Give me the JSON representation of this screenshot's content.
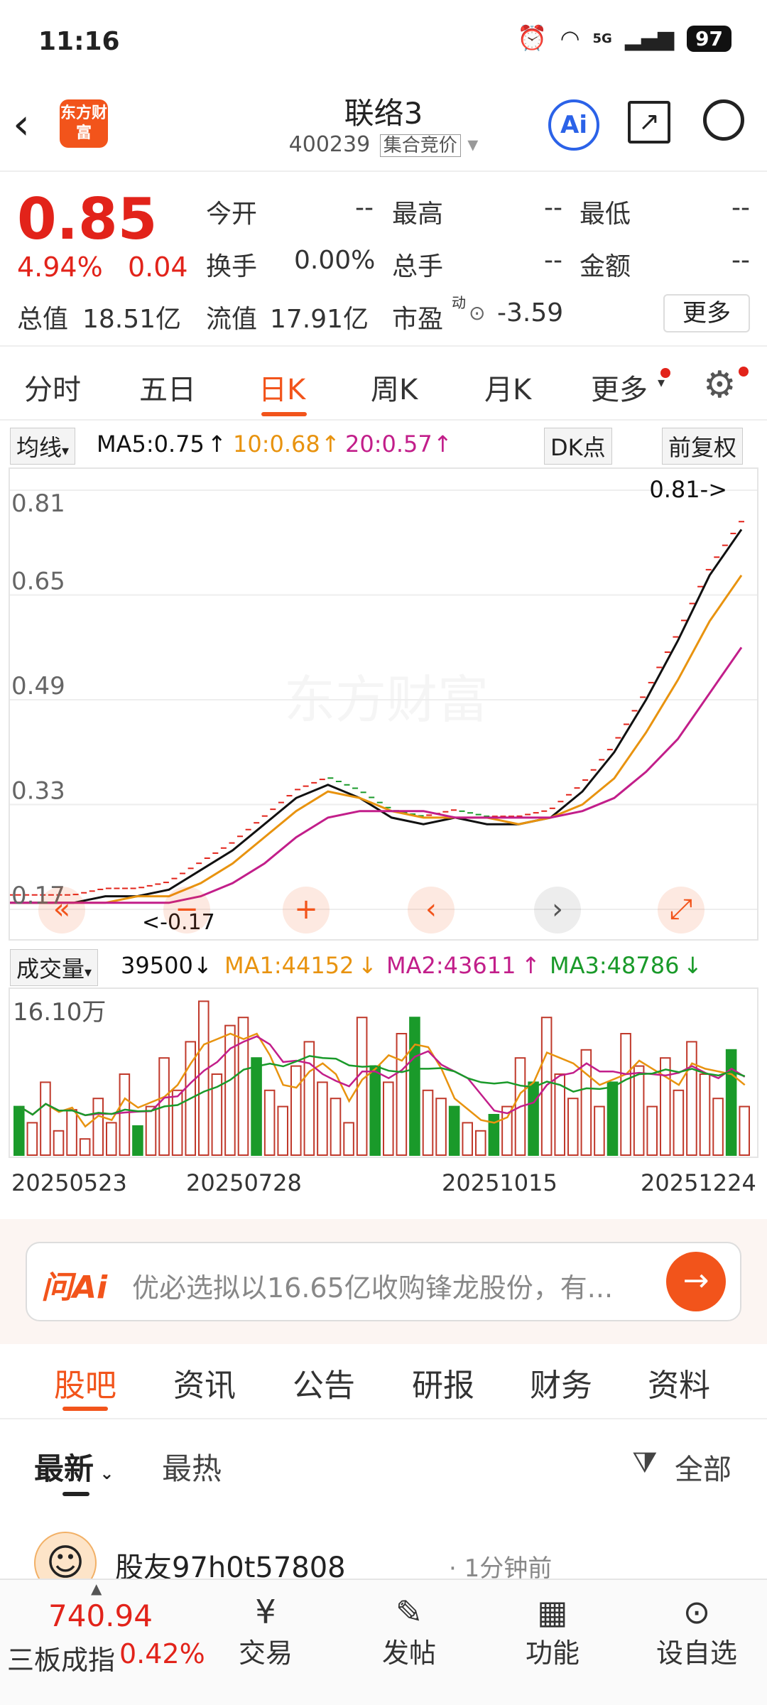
{
  "status": {
    "time": "11:16",
    "network": "5G",
    "battery": "97"
  },
  "header": {
    "logo_text": "东方财富",
    "title": "联络3",
    "code": "400239",
    "mode": "集合竞价",
    "ai_label": "Ai"
  },
  "quote": {
    "price": "0.85",
    "change_pct": "4.94%",
    "change": "0.04",
    "open_label": "今开",
    "open": "--",
    "high_label": "最高",
    "high": "--",
    "low_label": "最低",
    "low": "--",
    "turnover_label": "换手",
    "turnover": "0.00%",
    "volume_label": "总手",
    "volume": "--",
    "amount_label": "金额",
    "amount": "--",
    "mktcap_label": "总值",
    "mktcap": "18.51亿",
    "float_label": "流值",
    "float": "17.91亿",
    "pe_label": "市盈",
    "pe_sup": "动",
    "pe": "-3.59",
    "more": "更多"
  },
  "tabs": [
    "分时",
    "五日",
    "日K",
    "周K",
    "月K",
    "更多"
  ],
  "ma": {
    "label": "均线",
    "ma5": "MA5:0.75",
    "ma10": "10:0.68",
    "ma20": "20:0.57",
    "dk": "DK点",
    "adj": "前复权"
  },
  "chart_data": {
    "type": "line",
    "ylim": [
      0.17,
      0.81
    ],
    "y_ticks": [
      "0.81",
      "0.65",
      "0.49",
      "0.33",
      "0.17"
    ],
    "max_label": "0.81->",
    "min_label": "<-0.17",
    "x_labels": [
      "20250523",
      "20250728",
      "20251015",
      "20251224"
    ],
    "series": [
      {
        "name": "MA5",
        "color": "#111111",
        "values": [
          0.18,
          0.18,
          0.18,
          0.19,
          0.19,
          0.2,
          0.23,
          0.26,
          0.3,
          0.34,
          0.36,
          0.34,
          0.31,
          0.3,
          0.31,
          0.3,
          0.3,
          0.31,
          0.35,
          0.41,
          0.49,
          0.58,
          0.68,
          0.75
        ]
      },
      {
        "name": "10",
        "color": "#e8930f",
        "values": [
          0.18,
          0.18,
          0.18,
          0.18,
          0.19,
          0.19,
          0.21,
          0.24,
          0.28,
          0.32,
          0.35,
          0.34,
          0.32,
          0.31,
          0.31,
          0.31,
          0.3,
          0.31,
          0.33,
          0.37,
          0.44,
          0.52,
          0.61,
          0.68
        ]
      },
      {
        "name": "20",
        "color": "#c21e8a",
        "values": [
          0.18,
          0.18,
          0.18,
          0.18,
          0.18,
          0.18,
          0.19,
          0.21,
          0.24,
          0.28,
          0.31,
          0.32,
          0.32,
          0.32,
          0.31,
          0.31,
          0.31,
          0.31,
          0.32,
          0.34,
          0.38,
          0.43,
          0.5,
          0.57
        ]
      }
    ]
  },
  "volume": {
    "label": "成交量",
    "value": "39500",
    "ma1": "MA1:44152",
    "ma2": "MA2:43611",
    "ma3": "MA3:48786",
    "max": "16.10万",
    "bars": [
      0.3,
      0.2,
      0.45,
      0.15,
      0.28,
      0.1,
      0.35,
      0.2,
      0.5,
      0.18,
      0.3,
      0.6,
      0.4,
      0.7,
      0.95,
      0.5,
      0.8,
      0.85,
      0.6,
      0.4,
      0.3,
      0.55,
      0.7,
      0.45,
      0.35,
      0.2,
      0.85,
      0.55,
      0.45,
      0.75,
      0.85,
      0.4,
      0.35,
      0.3,
      0.2,
      0.15,
      0.25,
      0.3,
      0.6,
      0.45,
      0.85,
      0.5,
      0.35,
      0.65,
      0.3,
      0.45,
      0.75,
      0.55,
      0.3,
      0.6,
      0.4,
      0.7,
      0.5,
      0.35,
      0.65,
      0.3
    ]
  },
  "ask": {
    "brand": "问Ai",
    "text": "优必选拟以16.65亿收购锋龙股份，有..."
  },
  "sections": [
    "股吧",
    "资讯",
    "公告",
    "研报",
    "财务",
    "资料"
  ],
  "feed": {
    "latest": "最新",
    "hot": "最热",
    "filter": "全部",
    "user": "股友97h0t57808",
    "time": "1分钟前"
  },
  "bottom": {
    "index_value": "740.94",
    "index_name": "三板成指",
    "index_pct": "0.42%",
    "trade": "交易",
    "post": "发帖",
    "func": "功能",
    "watch": "设自选"
  }
}
